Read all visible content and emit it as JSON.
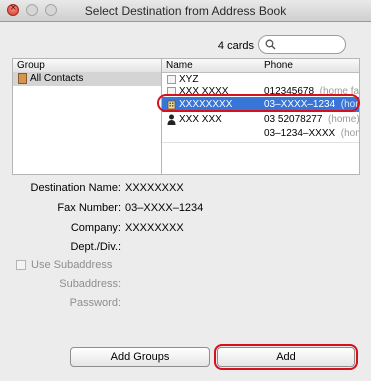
{
  "window": {
    "title": "Select Destination from Address Book"
  },
  "search": {
    "count_label": "4 cards",
    "value": ""
  },
  "groups": {
    "header": "Group",
    "items": [
      {
        "label": "All Contacts",
        "selected": true
      }
    ]
  },
  "cards": {
    "headers": {
      "name": "Name",
      "phone": "Phone"
    },
    "rows": [
      {
        "name": "XYZ",
        "phone": "",
        "phone_label": "",
        "icon": "card",
        "selected": false
      },
      {
        "name": "XXX XXXX",
        "phone": "012345678",
        "phone_label": "(home fa",
        "icon": "card",
        "selected": false
      },
      {
        "name": "XXXXXXXX",
        "phone": "03–XXXX–1234",
        "phone_label": "(hom",
        "icon": "building",
        "selected": true
      },
      {
        "name": "XXX XXX",
        "phone": "03 52078277",
        "phone_label": "(home)",
        "icon": "person",
        "selected": false
      },
      {
        "name": "",
        "phone": "03–1234–XXXX",
        "phone_label": "(hom",
        "icon": "",
        "selected": false
      }
    ]
  },
  "details": {
    "destination_name": {
      "label": "Destination Name:",
      "value": "XXXXXXXX"
    },
    "fax_number": {
      "label": "Fax Number:",
      "value": "03–XXXX–1234"
    },
    "company": {
      "label": "Company:",
      "value": "XXXXXXXX"
    },
    "dept": {
      "label": "Dept./Div.:",
      "value": ""
    },
    "use_subaddress": {
      "label": "Use Subaddress",
      "checked": false
    },
    "subaddress": {
      "label": "Subaddress:",
      "value": ""
    },
    "password": {
      "label": "Password:",
      "value": ""
    }
  },
  "buttons": {
    "add_groups": "Add Groups",
    "add": "Add"
  },
  "colors": {
    "selection": "#3875d7",
    "highlight_outline": "#d6101c"
  }
}
